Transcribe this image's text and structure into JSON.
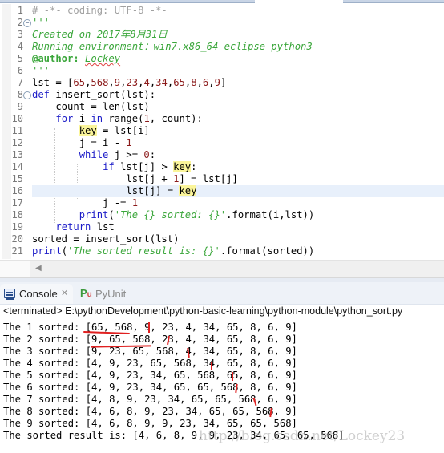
{
  "editor": {
    "current_line": 16,
    "fold_lines": [
      2,
      8
    ],
    "lines": [
      {
        "n": "1",
        "segments": [
          {
            "t": "# -*- coding: UTF-8 -*-",
            "c": "comment"
          }
        ]
      },
      {
        "n": "2",
        "segments": [
          {
            "t": "'''",
            "c": "docstr"
          }
        ]
      },
      {
        "n": "3",
        "segments": [
          {
            "t": "Created on 2017年8月31日",
            "c": "docstr"
          }
        ]
      },
      {
        "n": "4",
        "segments": [
          {
            "t": "Running environment：win7.x86_64 eclipse python3",
            "c": "docstr"
          }
        ]
      },
      {
        "n": "5",
        "segments": [
          {
            "t": "@author: ",
            "c": "deco"
          },
          {
            "t": "Lockey",
            "c": "author"
          }
        ]
      },
      {
        "n": "6",
        "segments": [
          {
            "t": "'''",
            "c": "docstr"
          }
        ]
      },
      {
        "n": "7",
        "segments": [
          {
            "t": "lst = [",
            "c": "ident"
          },
          {
            "t": "65",
            "c": "num"
          },
          {
            "t": ",",
            "c": "ident"
          },
          {
            "t": "568",
            "c": "num"
          },
          {
            "t": ",",
            "c": "ident"
          },
          {
            "t": "9",
            "c": "num"
          },
          {
            "t": ",",
            "c": "ident"
          },
          {
            "t": "23",
            "c": "num"
          },
          {
            "t": ",",
            "c": "ident"
          },
          {
            "t": "4",
            "c": "num"
          },
          {
            "t": ",",
            "c": "ident"
          },
          {
            "t": "34",
            "c": "num"
          },
          {
            "t": ",",
            "c": "ident"
          },
          {
            "t": "65",
            "c": "num"
          },
          {
            "t": ",",
            "c": "ident"
          },
          {
            "t": "8",
            "c": "num"
          },
          {
            "t": ",",
            "c": "ident"
          },
          {
            "t": "6",
            "c": "num"
          },
          {
            "t": ",",
            "c": "ident"
          },
          {
            "t": "9",
            "c": "num"
          },
          {
            "t": "]",
            "c": "ident"
          }
        ]
      },
      {
        "n": "8",
        "segments": [
          {
            "t": "def ",
            "c": "kw"
          },
          {
            "t": "insert_sort(lst):",
            "c": "ident"
          }
        ]
      },
      {
        "n": "9",
        "segments": [
          {
            "t": "    count = len(lst)",
            "c": "ident"
          }
        ]
      },
      {
        "n": "10",
        "segments": [
          {
            "t": "    ",
            "c": "ident"
          },
          {
            "t": "for",
            "c": "kw"
          },
          {
            "t": " i ",
            "c": "ident"
          },
          {
            "t": "in",
            "c": "kw"
          },
          {
            "t": " range(",
            "c": "ident"
          },
          {
            "t": "1",
            "c": "num"
          },
          {
            "t": ", count):",
            "c": "ident"
          }
        ]
      },
      {
        "n": "11",
        "segments": [
          {
            "t": "        ",
            "c": "ident"
          },
          {
            "t": "key",
            "c": "ident hl"
          },
          {
            "t": " = lst[i]",
            "c": "ident"
          }
        ]
      },
      {
        "n": "12",
        "segments": [
          {
            "t": "        j = i - ",
            "c": "ident"
          },
          {
            "t": "1",
            "c": "num"
          }
        ]
      },
      {
        "n": "13",
        "segments": [
          {
            "t": "        ",
            "c": "ident"
          },
          {
            "t": "while",
            "c": "kw"
          },
          {
            "t": " j >= ",
            "c": "ident"
          },
          {
            "t": "0",
            "c": "num"
          },
          {
            "t": ":",
            "c": "ident"
          }
        ]
      },
      {
        "n": "14",
        "segments": [
          {
            "t": "            ",
            "c": "ident"
          },
          {
            "t": "if",
            "c": "kw"
          },
          {
            "t": " lst[j] > ",
            "c": "ident"
          },
          {
            "t": "key",
            "c": "ident hl"
          },
          {
            "t": ":",
            "c": "ident"
          }
        ]
      },
      {
        "n": "15",
        "segments": [
          {
            "t": "                lst[j + ",
            "c": "ident"
          },
          {
            "t": "1",
            "c": "num"
          },
          {
            "t": "] = lst[j]",
            "c": "ident"
          }
        ]
      },
      {
        "n": "16",
        "segments": [
          {
            "t": "                lst[j] = ",
            "c": "ident"
          },
          {
            "t": "key",
            "c": "ident hl"
          }
        ]
      },
      {
        "n": "17",
        "segments": [
          {
            "t": "            j -= ",
            "c": "ident"
          },
          {
            "t": "1",
            "c": "num"
          }
        ]
      },
      {
        "n": "18",
        "segments": [
          {
            "t": "        ",
            "c": "ident"
          },
          {
            "t": "print",
            "c": "kw"
          },
          {
            "t": "(",
            "c": "ident"
          },
          {
            "t": "'The {} sorted: {}'",
            "c": "str"
          },
          {
            "t": ".format(i,lst))",
            "c": "ident"
          }
        ]
      },
      {
        "n": "19",
        "segments": [
          {
            "t": "    ",
            "c": "ident"
          },
          {
            "t": "return",
            "c": "kw"
          },
          {
            "t": " lst",
            "c": "ident"
          }
        ]
      },
      {
        "n": "20",
        "segments": [
          {
            "t": "sorted = insert_sort(lst)",
            "c": "ident"
          }
        ]
      },
      {
        "n": "21",
        "segments": [
          {
            "t": "print",
            "c": "kw"
          },
          {
            "t": "(",
            "c": "ident"
          },
          {
            "t": "'The sorted result is: {}'",
            "c": "str"
          },
          {
            "t": ".format(sorted))",
            "c": "ident"
          }
        ]
      }
    ]
  },
  "scrollbar": {
    "left_arrow": "◀"
  },
  "tabs": {
    "console": {
      "label": "Console",
      "icon": "console-icon",
      "close": "✕"
    },
    "pyunit": {
      "label": "PyUnit",
      "icon": "pyunit-icon",
      "icon_p": "P",
      "icon_u": "u"
    }
  },
  "console": {
    "status": "<terminated> E:\\pythonDevelopment\\python-basic-learning\\python-module\\python_sort.py",
    "output": [
      "The 1 sorted: [65, 568, 9, 23, 4, 34, 65, 8, 6, 9]",
      "The 2 sorted: [9, 65, 568, 23, 4, 34, 65, 8, 6, 9]",
      "The 3 sorted: [9, 23, 65, 568, 4, 34, 65, 8, 6, 9]",
      "The 4 sorted: [4, 9, 23, 65, 568, 34, 65, 8, 6, 9]",
      "The 5 sorted: [4, 9, 23, 34, 65, 568, 65, 8, 6, 9]",
      "The 6 sorted: [4, 9, 23, 34, 65, 65, 568, 8, 6, 9]",
      "The 7 sorted: [4, 8, 9, 23, 34, 65, 65, 568, 6, 9]",
      "The 8 sorted: [4, 6, 8, 9, 23, 34, 65, 65, 568, 9]",
      "The 9 sorted: [4, 6, 8, 9, 9, 23, 34, 65, 65, 568]",
      "The sorted result is: [4, 6, 8, 9, 9, 23, 34, 65, 65, 568]"
    ],
    "annotation_color": "#e02020"
  },
  "watermark": "http://blog.csdn.net/Lockey23"
}
